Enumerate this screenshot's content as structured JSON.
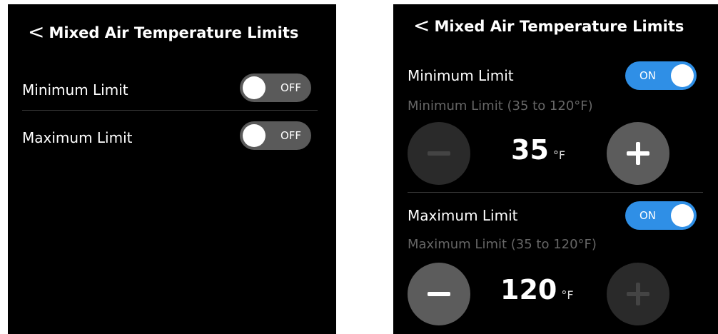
{
  "left_screen": {
    "title": "Mixed Air Temperature Limits",
    "back_glyph": "<",
    "rows": [
      {
        "label": "Minimum Limit",
        "toggle": "OFF"
      },
      {
        "label": "Maximum Limit",
        "toggle": "OFF"
      }
    ]
  },
  "right_screen": {
    "title": "Mixed Air Temperature Limits",
    "back_glyph": "<",
    "minimum": {
      "label": "Minimum Limit",
      "toggle": "ON",
      "range_label": "Minimum Limit (35 to 120°F)",
      "value": "35",
      "unit": "°F",
      "decrease_enabled": false,
      "increase_enabled": true
    },
    "maximum": {
      "label": "Maximum Limit",
      "toggle": "ON",
      "range_label": "Maximum Limit (35 to 120°F)",
      "value": "120",
      "unit": "°F",
      "decrease_enabled": true,
      "increase_enabled": false
    }
  },
  "colors": {
    "toggle_on": "#2f8fe6",
    "toggle_off": "#5a5a5a",
    "background": "#000000",
    "button_enabled": "#5c5c5c",
    "button_disabled": "#2a2a2a"
  }
}
